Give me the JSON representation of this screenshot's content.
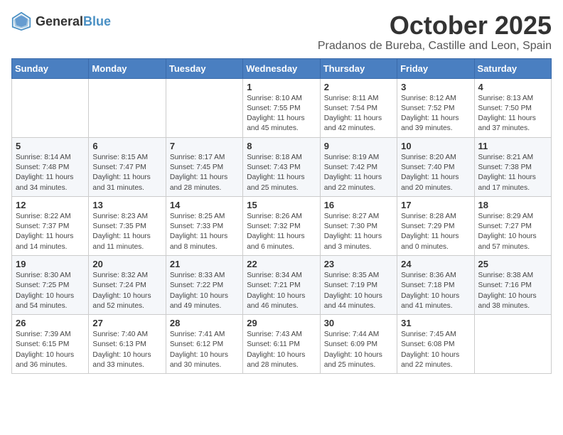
{
  "header": {
    "logo_general": "General",
    "logo_blue": "Blue",
    "month_year": "October 2025",
    "location": "Pradanos de Bureba, Castille and Leon, Spain"
  },
  "columns": [
    "Sunday",
    "Monday",
    "Tuesday",
    "Wednesday",
    "Thursday",
    "Friday",
    "Saturday"
  ],
  "weeks": [
    [
      {
        "day": "",
        "content": ""
      },
      {
        "day": "",
        "content": ""
      },
      {
        "day": "",
        "content": ""
      },
      {
        "day": "1",
        "content": "Sunrise: 8:10 AM\nSunset: 7:55 PM\nDaylight: 11 hours and 45 minutes."
      },
      {
        "day": "2",
        "content": "Sunrise: 8:11 AM\nSunset: 7:54 PM\nDaylight: 11 hours and 42 minutes."
      },
      {
        "day": "3",
        "content": "Sunrise: 8:12 AM\nSunset: 7:52 PM\nDaylight: 11 hours and 39 minutes."
      },
      {
        "day": "4",
        "content": "Sunrise: 8:13 AM\nSunset: 7:50 PM\nDaylight: 11 hours and 37 minutes."
      }
    ],
    [
      {
        "day": "5",
        "content": "Sunrise: 8:14 AM\nSunset: 7:48 PM\nDaylight: 11 hours and 34 minutes."
      },
      {
        "day": "6",
        "content": "Sunrise: 8:15 AM\nSunset: 7:47 PM\nDaylight: 11 hours and 31 minutes."
      },
      {
        "day": "7",
        "content": "Sunrise: 8:17 AM\nSunset: 7:45 PM\nDaylight: 11 hours and 28 minutes."
      },
      {
        "day": "8",
        "content": "Sunrise: 8:18 AM\nSunset: 7:43 PM\nDaylight: 11 hours and 25 minutes."
      },
      {
        "day": "9",
        "content": "Sunrise: 8:19 AM\nSunset: 7:42 PM\nDaylight: 11 hours and 22 minutes."
      },
      {
        "day": "10",
        "content": "Sunrise: 8:20 AM\nSunset: 7:40 PM\nDaylight: 11 hours and 20 minutes."
      },
      {
        "day": "11",
        "content": "Sunrise: 8:21 AM\nSunset: 7:38 PM\nDaylight: 11 hours and 17 minutes."
      }
    ],
    [
      {
        "day": "12",
        "content": "Sunrise: 8:22 AM\nSunset: 7:37 PM\nDaylight: 11 hours and 14 minutes."
      },
      {
        "day": "13",
        "content": "Sunrise: 8:23 AM\nSunset: 7:35 PM\nDaylight: 11 hours and 11 minutes."
      },
      {
        "day": "14",
        "content": "Sunrise: 8:25 AM\nSunset: 7:33 PM\nDaylight: 11 hours and 8 minutes."
      },
      {
        "day": "15",
        "content": "Sunrise: 8:26 AM\nSunset: 7:32 PM\nDaylight: 11 hours and 6 minutes."
      },
      {
        "day": "16",
        "content": "Sunrise: 8:27 AM\nSunset: 7:30 PM\nDaylight: 11 hours and 3 minutes."
      },
      {
        "day": "17",
        "content": "Sunrise: 8:28 AM\nSunset: 7:29 PM\nDaylight: 11 hours and 0 minutes."
      },
      {
        "day": "18",
        "content": "Sunrise: 8:29 AM\nSunset: 7:27 PM\nDaylight: 10 hours and 57 minutes."
      }
    ],
    [
      {
        "day": "19",
        "content": "Sunrise: 8:30 AM\nSunset: 7:25 PM\nDaylight: 10 hours and 54 minutes."
      },
      {
        "day": "20",
        "content": "Sunrise: 8:32 AM\nSunset: 7:24 PM\nDaylight: 10 hours and 52 minutes."
      },
      {
        "day": "21",
        "content": "Sunrise: 8:33 AM\nSunset: 7:22 PM\nDaylight: 10 hours and 49 minutes."
      },
      {
        "day": "22",
        "content": "Sunrise: 8:34 AM\nSunset: 7:21 PM\nDaylight: 10 hours and 46 minutes."
      },
      {
        "day": "23",
        "content": "Sunrise: 8:35 AM\nSunset: 7:19 PM\nDaylight: 10 hours and 44 minutes."
      },
      {
        "day": "24",
        "content": "Sunrise: 8:36 AM\nSunset: 7:18 PM\nDaylight: 10 hours and 41 minutes."
      },
      {
        "day": "25",
        "content": "Sunrise: 8:38 AM\nSunset: 7:16 PM\nDaylight: 10 hours and 38 minutes."
      }
    ],
    [
      {
        "day": "26",
        "content": "Sunrise: 7:39 AM\nSunset: 6:15 PM\nDaylight: 10 hours and 36 minutes."
      },
      {
        "day": "27",
        "content": "Sunrise: 7:40 AM\nSunset: 6:13 PM\nDaylight: 10 hours and 33 minutes."
      },
      {
        "day": "28",
        "content": "Sunrise: 7:41 AM\nSunset: 6:12 PM\nDaylight: 10 hours and 30 minutes."
      },
      {
        "day": "29",
        "content": "Sunrise: 7:43 AM\nSunset: 6:11 PM\nDaylight: 10 hours and 28 minutes."
      },
      {
        "day": "30",
        "content": "Sunrise: 7:44 AM\nSunset: 6:09 PM\nDaylight: 10 hours and 25 minutes."
      },
      {
        "day": "31",
        "content": "Sunrise: 7:45 AM\nSunset: 6:08 PM\nDaylight: 10 hours and 22 minutes."
      },
      {
        "day": "",
        "content": ""
      }
    ]
  ]
}
